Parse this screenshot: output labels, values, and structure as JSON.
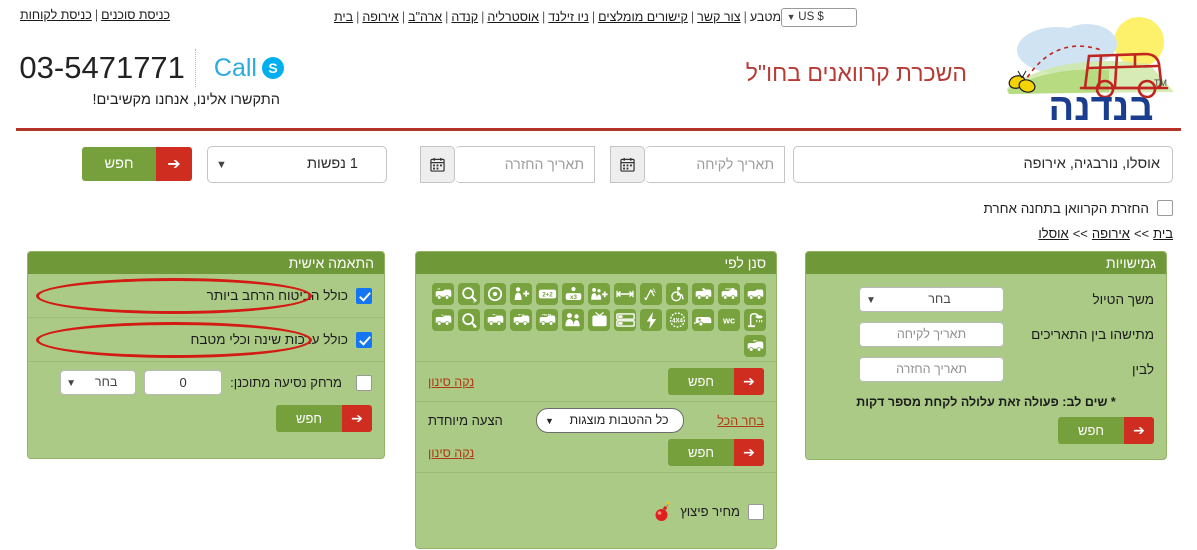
{
  "top": {
    "left_links": [
      {
        "label": "כניסת סוכנים"
      },
      {
        "label": "כניסת לקוחות"
      }
    ],
    "nav_links": [
      {
        "label": "בית"
      },
      {
        "label": "אירופה"
      },
      {
        "label": "ארה\"ב"
      },
      {
        "label": "קנדה"
      },
      {
        "label": "אוסטרליה"
      },
      {
        "label": "ניו זילנד"
      },
      {
        "label": "קישורים מומלצים"
      },
      {
        "label": "צור קשר"
      }
    ],
    "currency_label": "מטבע",
    "currency_value": "US $",
    "separator": "|"
  },
  "brand": {
    "logo_text": "בנדנה",
    "logo_tm": "TM"
  },
  "contact": {
    "skype_label": "Call",
    "skype_icon": "skype-icon",
    "phone": "03-5471771",
    "tagline": "התקשרו אלינו, אנחנו מקשיבים!"
  },
  "header": {
    "title": "השכרת קרוואנים בחו\"ל",
    "title_color": "#b63b35"
  },
  "search": {
    "location_value": "אוסלו, נורבגיה, אירופה",
    "pickup_placeholder": "תאריך לקיחה",
    "dropoff_placeholder": "תאריך החזרה",
    "pax_value": "1 נפשות",
    "search_label": "חפש",
    "calendar_icon": "calendar-icon",
    "arrow_icon": "arrow-left-icon"
  },
  "return_option": {
    "label": "החזרת הקרוואן בתחנה אחרת",
    "checked": false
  },
  "breadcrumb": {
    "items": [
      {
        "label": "בית"
      },
      {
        "label": "אירופה"
      },
      {
        "label": "אוסלו"
      }
    ],
    "separator": ">>"
  },
  "panels": {
    "personal": {
      "title": "התאמה אישית",
      "options": [
        {
          "label": "כולל הביטוח הרחב ביותר",
          "checked": true,
          "annotated": true
        },
        {
          "label": "כולל ערכות שינה וכלי מטבח",
          "checked": true,
          "annotated": true
        }
      ],
      "distance": {
        "label": "מרחק נסיעה מתוכנן:",
        "checked": false,
        "value": "0",
        "unit_value": "בחר"
      },
      "search_label": "חפש"
    },
    "filter": {
      "title": "סנן לפי",
      "icons": [
        {
          "name": "van-icon",
          "glyph": "van"
        },
        {
          "name": "van-length-icon",
          "glyph": "van-arrow"
        },
        {
          "name": "van-height-icon",
          "glyph": "van-down"
        },
        {
          "name": "wheelchair-icon",
          "glyph": "wheelchair"
        },
        {
          "name": "automatic-transmission-icon",
          "glyph": "auto-a"
        },
        {
          "name": "length-measure-icon",
          "glyph": "arrows-h"
        },
        {
          "name": "family-plus-icon",
          "glyph": "family-plus"
        },
        {
          "name": "sleeps-3-icon",
          "glyph": "x3"
        },
        {
          "name": "berths-2plus2-icon",
          "glyph": "2+2"
        },
        {
          "name": "person-plus-icon",
          "glyph": "person-plus"
        },
        {
          "name": "steering-wheel-icon",
          "glyph": "wheel"
        },
        {
          "name": "query-y-icon",
          "glyph": "qy"
        },
        {
          "name": "van-s-icon",
          "glyph": "van-s"
        },
        {
          "name": "shower-icon",
          "glyph": "shower"
        },
        {
          "name": "wc-icon",
          "glyph": "wc"
        },
        {
          "name": "caravan-trailer-icon",
          "glyph": "trailer"
        },
        {
          "name": "four-wheel-drive-icon",
          "glyph": "4x4"
        },
        {
          "name": "electricity-icon",
          "glyph": "bolt"
        },
        {
          "name": "bunk-bed-icon",
          "glyph": "bunk"
        },
        {
          "name": "tv-icon",
          "glyph": "tv"
        },
        {
          "name": "group-people-icon",
          "glyph": "group"
        },
        {
          "name": "new-van-icon",
          "glyph": "van-new"
        },
        {
          "name": "van-0-3-icon",
          "glyph": "van-03"
        },
        {
          "name": "van-plus-4-icon",
          "glyph": "van-p4"
        },
        {
          "name": "query-c-icon",
          "glyph": "qc"
        },
        {
          "name": "van-l-icon",
          "glyph": "van-l"
        },
        {
          "name": "van-m-icon",
          "glyph": "van-m"
        }
      ],
      "clear_filter_label": "נקה סינון",
      "search_label": "חפש",
      "special_offer_label": "הצעה מיוחדת",
      "offer_select_value": "כל ההטבות מוצגות",
      "choose_all_label": "בחר הכל",
      "clear_filter_label_2": "נקה סינון",
      "boom_label": "מחיר פיצוץ",
      "boom_checked": false,
      "boom_icon": "bomb-icon"
    },
    "flex": {
      "title": "גמישויות",
      "rows": [
        {
          "label": "משך הטיול",
          "type": "select",
          "value": "בחר"
        },
        {
          "label": "מתישהו בין התאריכים",
          "type": "input",
          "placeholder": "תאריך לקיחה"
        },
        {
          "label": "לבין",
          "type": "input",
          "placeholder": "תאריך החזרה"
        }
      ],
      "note": "* שים לב: פעולה זאת עלולה לקחת מספר דקות",
      "search_label": "חפש"
    }
  },
  "colors": {
    "panel_header_green": "#6f9938",
    "panel_body_green": "#abca86",
    "button_green": "#76a03c",
    "button_red": "#cf2d20",
    "rule_red": "#b4342c",
    "title_red": "#b63b35",
    "annotation_red": "#d31b13",
    "checkbox_blue": "#1476f2",
    "skype_blue": "#29abe2",
    "link_orange": "#b03a13"
  }
}
